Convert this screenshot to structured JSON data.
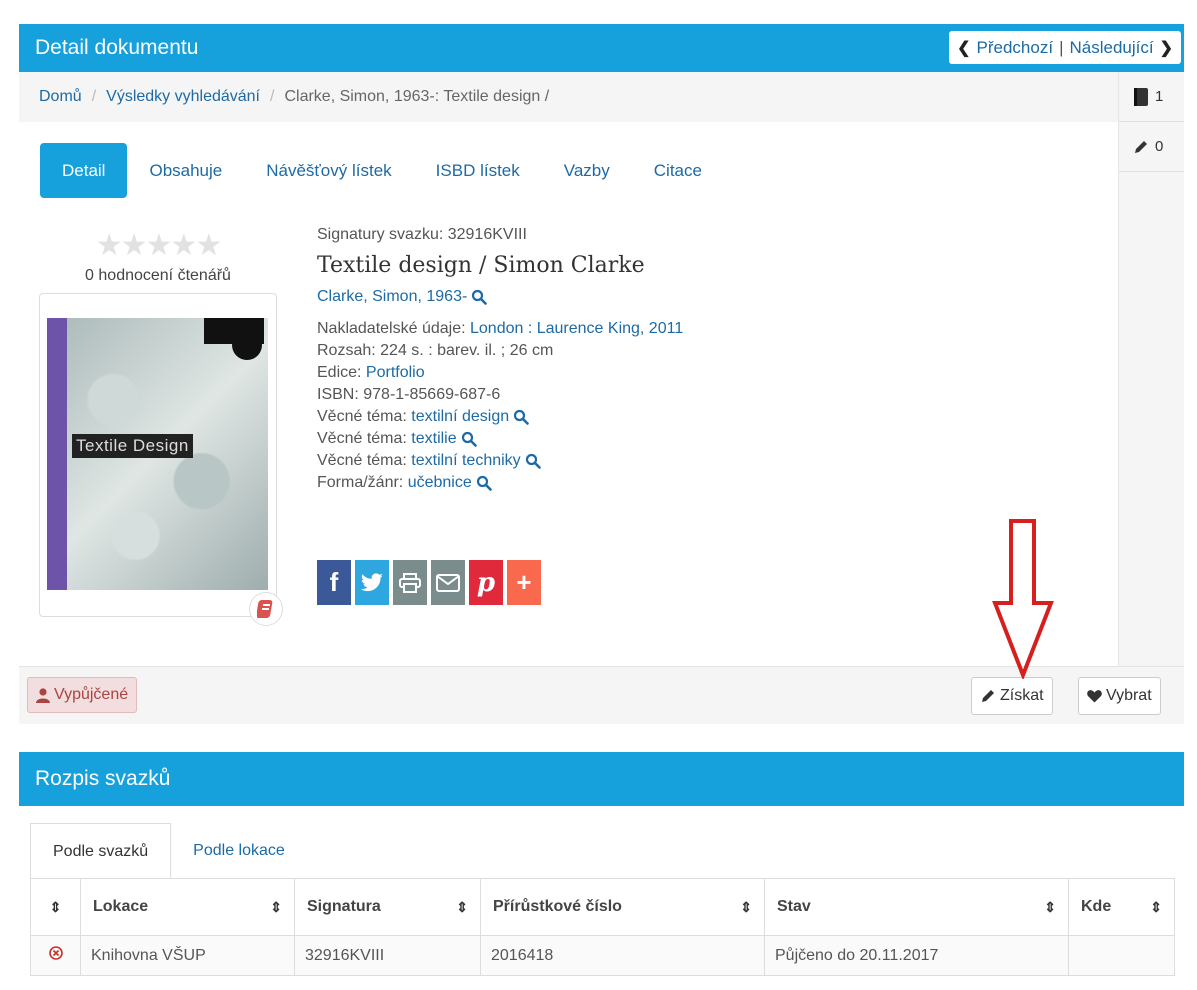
{
  "detail_panel": {
    "title": "Detail dokumentu",
    "pager": {
      "prev": "Předchozí",
      "next": "Následující"
    }
  },
  "breadcrumb": {
    "home": "Domů",
    "results": "Výsledky vyhledávání",
    "current": "Clarke, Simon, 1963-: Textile design /"
  },
  "side": {
    "books_count": "1",
    "notes_count": "0"
  },
  "tabs": [
    "Detail",
    "Obsahuje",
    "Návěšťový lístek",
    "ISBD lístek",
    "Vazby",
    "Citace"
  ],
  "rating": {
    "stars": "★★★★★",
    "text": "0 hodnocení čtenářů"
  },
  "cover": {
    "title": "Textile Design"
  },
  "record": {
    "signature_label": "Signatury svazku:",
    "signature": "32916KVIII",
    "title": "Textile design / Simon Clarke",
    "author": "Clarke, Simon, 1963-",
    "publisher_label": "Nakladatelské údaje:",
    "publisher": "London : Laurence King, 2011",
    "extent_label": "Rozsah:",
    "extent": "224 s. : barev. il. ; 26 cm",
    "series_label": "Edice:",
    "series": "Portfolio",
    "isbn_label": "ISBN:",
    "isbn": "978-1-85669-687-6",
    "subject_label": "Věcné téma:",
    "subjects": [
      "textilní design",
      "textilie",
      "textilní techniky"
    ],
    "genre_label": "Forma/žánr:",
    "genre": "učebnice"
  },
  "share": {
    "facebook": "f",
    "twitter": "t",
    "print": "print",
    "email": "mail",
    "pinterest": "p",
    "more": "+"
  },
  "footer": {
    "borrowed": "Vypůjčené",
    "get": "Získat",
    "select": "Vybrat"
  },
  "volumes_panel": {
    "title": "Rozpis svazků"
  },
  "volume_tabs": [
    "Podle svazků",
    "Podle lokace"
  ],
  "table": {
    "headers": [
      "Lokace",
      "Signatura",
      "Přírůstkové číslo",
      "Stav",
      "Kde"
    ],
    "rows": [
      {
        "location": "Knihovna VŠUP",
        "signature": "32916KVIII",
        "accession": "2016418",
        "status": "Půjčeno do 20.11.2017",
        "where": ""
      }
    ]
  },
  "colors": {
    "accent": "#16a0dc",
    "link": "#1d6aa5",
    "danger": "#a94442",
    "arrow": "#d62020"
  }
}
